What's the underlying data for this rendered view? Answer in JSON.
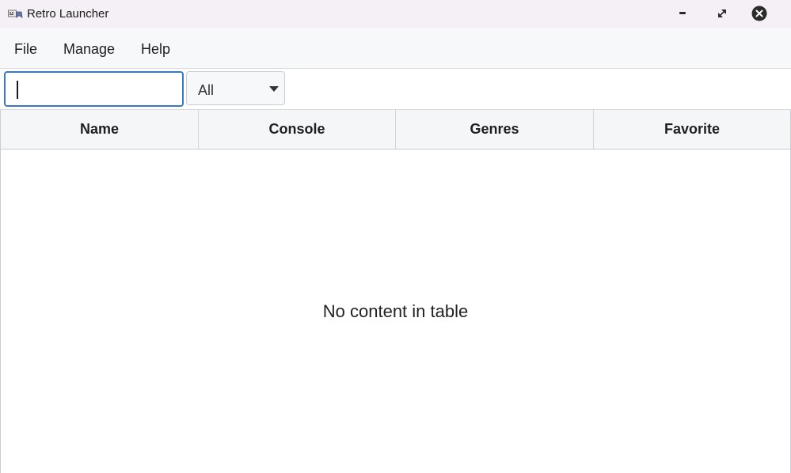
{
  "window": {
    "title": "Retro Launcher",
    "controls": [
      "minimize",
      "maximize",
      "close"
    ]
  },
  "menu": {
    "items": [
      {
        "label": "File"
      },
      {
        "label": "Manage"
      },
      {
        "label": "Help"
      }
    ]
  },
  "toolbar": {
    "search": {
      "value": "",
      "placeholder": ""
    },
    "filter": {
      "selected": "All"
    }
  },
  "table": {
    "columns": [
      "Name",
      "Console",
      "Genres",
      "Favorite"
    ],
    "rows": [],
    "empty_message": "No content in table"
  },
  "colors": {
    "accent": "#3b78c4",
    "titlebar": "#f5f0f5",
    "menubar": "#f7f8fa",
    "header": "#f5f6f8"
  },
  "icons": {
    "app": "gamepad-icon",
    "minimize": "minimize-icon",
    "maximize": "maximize-icon",
    "close": "close-icon",
    "dropdown": "chevron-down-icon"
  }
}
